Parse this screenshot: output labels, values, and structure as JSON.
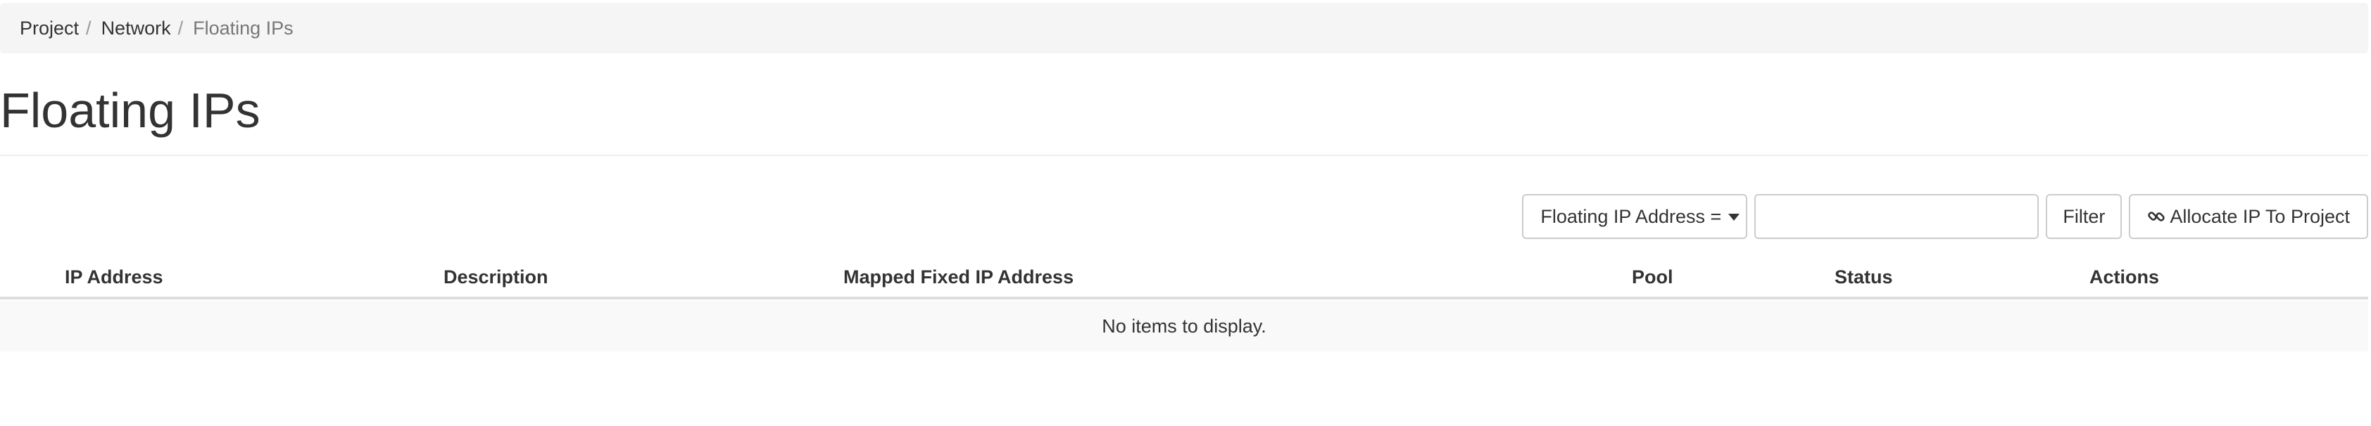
{
  "breadcrumb": {
    "items": [
      {
        "label": "Project"
      },
      {
        "label": "Network"
      }
    ],
    "active": "Floating IPs",
    "separator": "/"
  },
  "page": {
    "title": "Floating IPs"
  },
  "toolbar": {
    "filter_field_label": "Floating IP Address =",
    "filter_value": "",
    "filter_button": "Filter",
    "allocate_button": "Allocate IP To Project",
    "icons": {
      "filter_field": "caret-down-icon",
      "allocate": "link-icon"
    }
  },
  "table": {
    "columns": [
      "IP Address",
      "Description",
      "Mapped Fixed IP Address",
      "Pool",
      "Status",
      "Actions"
    ],
    "rows": [],
    "empty_message": "No items to display."
  },
  "colors": {
    "breadcrumb_bg": "#f5f5f5",
    "text": "#333333",
    "muted": "#777777",
    "empty_row_bg": "#f9f9f9",
    "border": "#cccccc"
  }
}
